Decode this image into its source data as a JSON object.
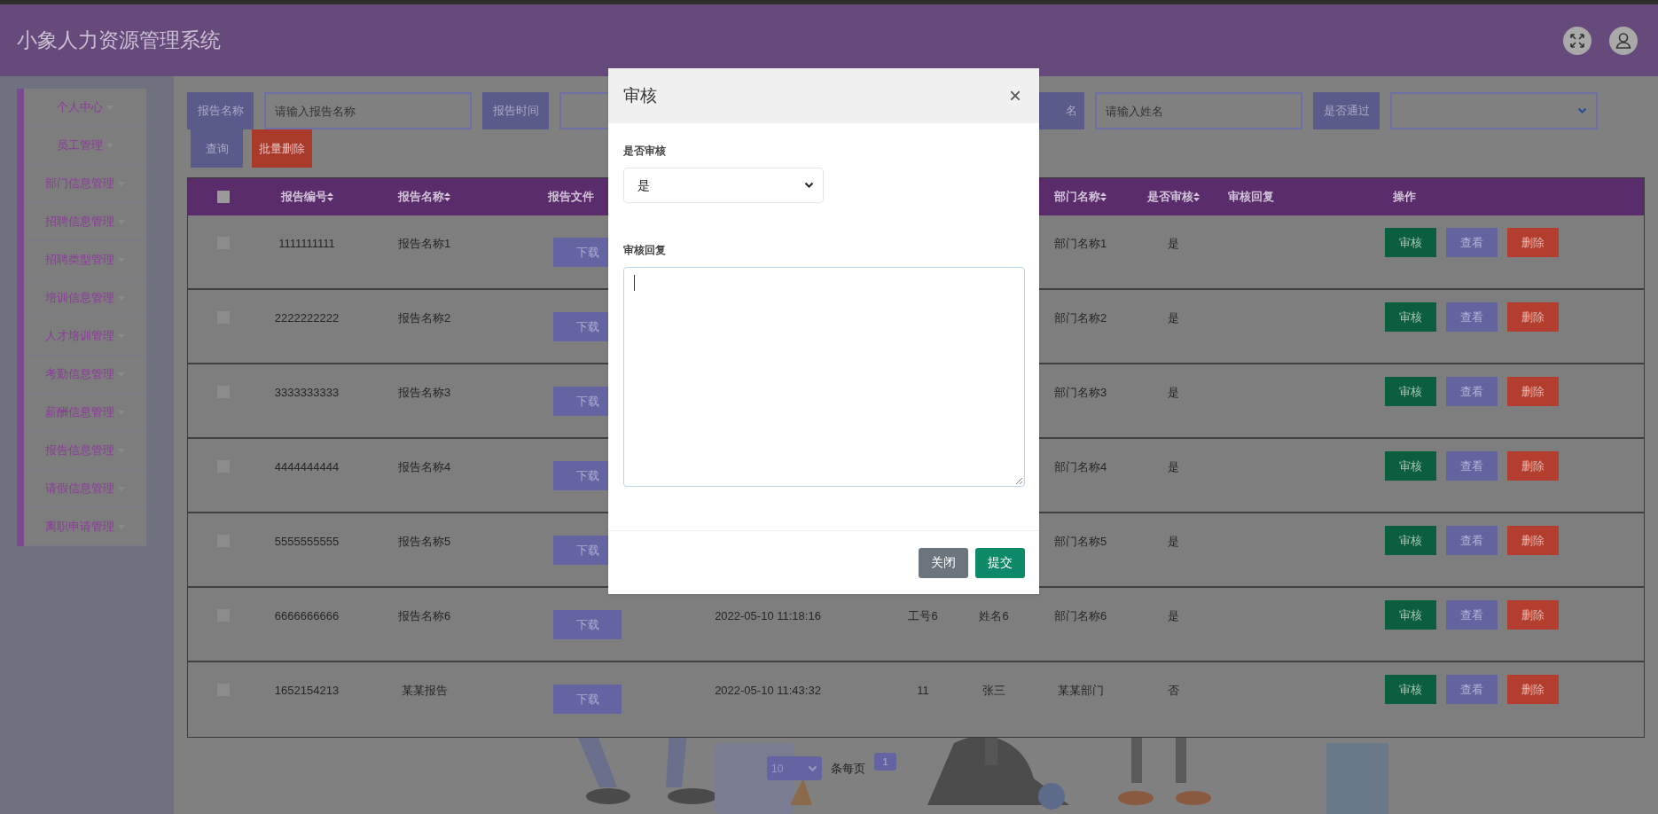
{
  "app_title": "小象人力资源管理系统",
  "sidebar": {
    "items": [
      {
        "label": "个人中心"
      },
      {
        "label": "员工管理"
      },
      {
        "label": "部门信息管理"
      },
      {
        "label": "招聘信息管理"
      },
      {
        "label": "招聘类型管理"
      },
      {
        "label": "培训信息管理"
      },
      {
        "label": "人才培训管理"
      },
      {
        "label": "考勤信息管理"
      },
      {
        "label": "薪酬信息管理"
      },
      {
        "label": "报告信息管理"
      },
      {
        "label": "请假信息管理"
      },
      {
        "label": "离职申请管理"
      }
    ]
  },
  "search": {
    "fields": [
      {
        "kind": "input",
        "label": "报告名称",
        "placeholder": "请输入报告名称"
      },
      {
        "kind": "input",
        "label": "报告时间"
      },
      {
        "kind": "input",
        "label": "名",
        "placeholder": "请输入姓名"
      },
      {
        "kind": "select",
        "label": "是否通过"
      }
    ],
    "buttons": [
      {
        "kind": "query",
        "label": "查询"
      },
      {
        "kind": "danger",
        "label": "批量删除"
      }
    ]
  },
  "table": {
    "select_all": {
      "checked": false
    },
    "columns": [
      {
        "label": "报告编号",
        "sortable": true
      },
      {
        "label": "报告名称",
        "sortable": true
      },
      {
        "label": "报告文件",
        "sortable": false
      },
      null,
      null,
      null,
      {
        "label": "部门名称",
        "sortable": true
      },
      {
        "label": "是否审核",
        "sortable": true
      },
      {
        "label": "审核回复",
        "sortable": false
      },
      {
        "label": "操作",
        "sortable": false
      }
    ],
    "rows": [
      {
        "checked": false,
        "cells": [
          "1111111111",
          "报告名称1",
          "下载",
          null,
          null,
          null,
          "部门名称1",
          "是",
          null
        ],
        "actions": [
          {
            "kind": "review",
            "label": "审核"
          },
          {
            "kind": "view",
            "label": "查看"
          },
          {
            "kind": "delete",
            "label": "删除"
          }
        ]
      },
      {
        "checked": false,
        "cells": [
          "2222222222",
          "报告名称2",
          "下载",
          null,
          null,
          null,
          "部门名称2",
          "是",
          null
        ],
        "actions": [
          {
            "kind": "review",
            "label": "审核"
          },
          {
            "kind": "view",
            "label": "查看"
          },
          {
            "kind": "delete",
            "label": "删除"
          }
        ]
      },
      {
        "checked": false,
        "cells": [
          "3333333333",
          "报告名称3",
          "下载",
          null,
          null,
          null,
          "部门名称3",
          "是",
          null
        ],
        "actions": [
          {
            "kind": "review",
            "label": "审核"
          },
          {
            "kind": "view",
            "label": "查看"
          },
          {
            "kind": "delete",
            "label": "删除"
          }
        ]
      },
      {
        "checked": false,
        "cells": [
          "4444444444",
          "报告名称4",
          "下载",
          null,
          null,
          null,
          "部门名称4",
          "是",
          null
        ],
        "actions": [
          {
            "kind": "review",
            "label": "审核"
          },
          {
            "kind": "view",
            "label": "查看"
          },
          {
            "kind": "delete",
            "label": "删除"
          }
        ]
      },
      {
        "checked": false,
        "cells": [
          "5555555555",
          "报告名称5",
          "下载",
          null,
          null,
          null,
          "部门名称5",
          "是",
          null
        ],
        "actions": [
          {
            "kind": "review",
            "label": "审核"
          },
          {
            "kind": "view",
            "label": "查看"
          },
          {
            "kind": "delete",
            "label": "删除"
          }
        ]
      },
      {
        "checked": false,
        "cells": [
          "6666666666",
          "报告名称6",
          "下载",
          "2022-05-10 11:18:16",
          "工号6",
          "姓名6",
          "部门名称6",
          "是",
          null
        ],
        "actions": [
          {
            "kind": "review",
            "label": "审核"
          },
          {
            "kind": "view",
            "label": "查看"
          },
          {
            "kind": "delete",
            "label": "删除"
          }
        ]
      },
      {
        "checked": false,
        "cells": [
          "1652154213",
          "某某报告",
          "下载",
          "2022-05-10 11:43:32",
          "11",
          "张三",
          "某某部门",
          "否",
          null
        ],
        "actions": [
          {
            "kind": "review",
            "label": "审核"
          },
          {
            "kind": "view",
            "label": "查看"
          },
          {
            "kind": "delete",
            "label": "删除"
          }
        ]
      }
    ]
  },
  "pagination": {
    "page_size": "10",
    "per_page_label": "条每页",
    "pages": [
      {
        "label": "1",
        "selected": true
      }
    ]
  },
  "modal": {
    "title": "审核",
    "close": "×",
    "fields": [
      {
        "kind": "select",
        "label": "是否审核",
        "value": "是"
      },
      {
        "kind": "textarea",
        "label": "审核回复",
        "focused": true
      }
    ],
    "buttons": [
      {
        "kind": "secondary",
        "label": "关闭"
      },
      {
        "kind": "primary",
        "label": "提交"
      }
    ]
  }
}
